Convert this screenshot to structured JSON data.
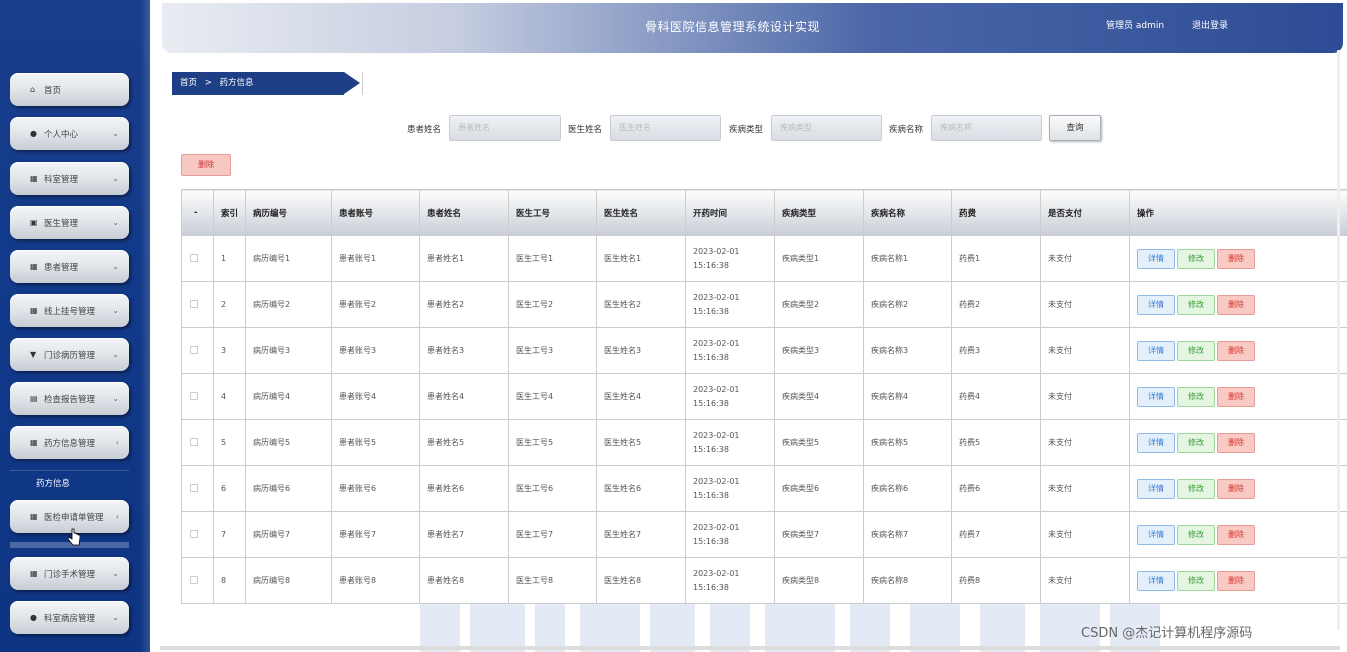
{
  "header": {
    "title": "骨科医院信息管理系统设计实现",
    "user": "管理员 admin",
    "logout": "退出登录"
  },
  "sidebar": {
    "items": [
      {
        "label": "首页",
        "icon": "home-icon",
        "glyph": "⌂",
        "chev": ""
      },
      {
        "label": "个人中心",
        "icon": "user-icon",
        "glyph": "●",
        "chev": "⌄"
      },
      {
        "label": "科室管理",
        "icon": "grid-icon",
        "glyph": "▦",
        "chev": "⌄"
      },
      {
        "label": "医生管理",
        "icon": "doc-icon",
        "glyph": "▣",
        "chev": "⌄"
      },
      {
        "label": "患者管理",
        "icon": "grid-icon",
        "glyph": "▦",
        "chev": "⌄"
      },
      {
        "label": "线上挂号管理",
        "icon": "grid-icon",
        "glyph": "▦",
        "chev": "⌄"
      },
      {
        "label": "门诊病历管理",
        "icon": "flag-icon",
        "glyph": "▼",
        "chev": "⌄"
      },
      {
        "label": "检查报告管理",
        "icon": "lock-icon",
        "glyph": "▤",
        "chev": "⌄"
      },
      {
        "label": "药方信息管理",
        "icon": "grid-icon",
        "glyph": "▦",
        "chev": "‹"
      },
      {
        "label": "医检申请单管理",
        "icon": "grid-icon",
        "glyph": "▦",
        "chev": "‹"
      },
      {
        "label": "门诊手术管理",
        "icon": "grid-icon",
        "glyph": "▦",
        "chev": "⌄"
      },
      {
        "label": "科室病房管理",
        "icon": "user-icon",
        "glyph": "●",
        "chev": "⌄"
      }
    ],
    "sub_item": "药方信息"
  },
  "breadcrumb": {
    "home": "首页",
    "sep": ">",
    "current": "药方信息"
  },
  "search": {
    "fields": [
      {
        "label": "患者姓名",
        "placeholder": "患者姓名"
      },
      {
        "label": "医生姓名",
        "placeholder": "医生姓名"
      },
      {
        "label": "疾病类型",
        "placeholder": "疾病类型"
      },
      {
        "label": "疾病名称",
        "placeholder": "疾病名称"
      }
    ],
    "button": "查询"
  },
  "toolbar": {
    "delete": "删除"
  },
  "table": {
    "columns": [
      "",
      "索引",
      "病历编号",
      "患者账号",
      "患者姓名",
      "医生工号",
      "医生姓名",
      "开药时间",
      "疾病类型",
      "疾病名称",
      "药费",
      "是否支付",
      "操作"
    ],
    "rows": [
      [
        "1",
        "病历编号1",
        "患者账号1",
        "患者姓名1",
        "医生工号1",
        "医生姓名1",
        "2023-02-01 15:16:38",
        "疾病类型1",
        "疾病名称1",
        "药费1",
        "未支付"
      ],
      [
        "2",
        "病历编号2",
        "患者账号2",
        "患者姓名2",
        "医生工号2",
        "医生姓名2",
        "2023-02-01 15:16:38",
        "疾病类型2",
        "疾病名称2",
        "药费2",
        "未支付"
      ],
      [
        "3",
        "病历编号3",
        "患者账号3",
        "患者姓名3",
        "医生工号3",
        "医生姓名3",
        "2023-02-01 15:16:38",
        "疾病类型3",
        "疾病名称3",
        "药费3",
        "未支付"
      ],
      [
        "4",
        "病历编号4",
        "患者账号4",
        "患者姓名4",
        "医生工号4",
        "医生姓名4",
        "2023-02-01 15:16:38",
        "疾病类型4",
        "疾病名称4",
        "药费4",
        "未支付"
      ],
      [
        "5",
        "病历编号5",
        "患者账号5",
        "患者姓名5",
        "医生工号5",
        "医生姓名5",
        "2023-02-01 15:16:38",
        "疾病类型5",
        "疾病名称5",
        "药费5",
        "未支付"
      ],
      [
        "6",
        "病历编号6",
        "患者账号6",
        "患者姓名6",
        "医生工号6",
        "医生姓名6",
        "2023-02-01 15:16:38",
        "疾病类型6",
        "疾病名称6",
        "药费6",
        "未支付"
      ],
      [
        "7",
        "病历编号7",
        "患者账号7",
        "患者姓名7",
        "医生工号7",
        "医生姓名7",
        "2023-02-01 15:16:38",
        "疾病类型7",
        "疾病名称7",
        "药费7",
        "未支付"
      ],
      [
        "8",
        "病历编号8",
        "患者账号8",
        "患者姓名8",
        "医生工号8",
        "医生姓名8",
        "2023-02-01 15:16:38",
        "疾病类型8",
        "疾病名称8",
        "药费8",
        "未支付"
      ]
    ],
    "actions": {
      "detail": "详情",
      "edit": "修改",
      "delete": "删除"
    }
  },
  "watermark": "CSDN @杰记计算机程序源码",
  "colors": {
    "sidebar": "#123a8a",
    "header_accent": "#2d4c95",
    "crumb": "#1e3f86",
    "danger": "#d0342b",
    "info": "#3a7bd5",
    "success": "#3c9a35"
  }
}
